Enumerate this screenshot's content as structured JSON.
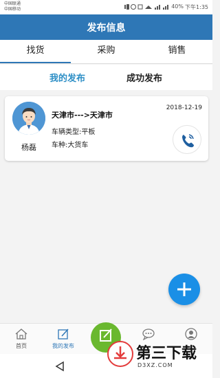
{
  "status_bar": {
    "carrier_1": "中国联通",
    "carrier_2": "中国移动",
    "battery": "40%",
    "time": "下午1:35"
  },
  "header": {
    "title": "发布信息"
  },
  "tabs": [
    {
      "label": "找货",
      "active": true
    },
    {
      "label": "采购",
      "active": false
    },
    {
      "label": "销售",
      "active": false
    }
  ],
  "sub_tabs": [
    {
      "label": "我的发布",
      "active": true
    },
    {
      "label": "成功发布",
      "active": false
    }
  ],
  "listing": {
    "contact_name": "杨磊",
    "route": "天津市--->天津市",
    "date": "2018-12-19",
    "vehicle_type": "车辆类型:平板",
    "cargo_type": "车种:大货车"
  },
  "bottom_nav": [
    {
      "label": "首页",
      "icon": "home-icon",
      "active": false
    },
    {
      "label": "我的发布",
      "icon": "edit-icon",
      "active": true
    },
    {
      "label": "",
      "icon": "post-icon",
      "active": false
    },
    {
      "label": "",
      "icon": "chat-icon",
      "active": false
    },
    {
      "label": "",
      "icon": "user-icon",
      "active": false
    }
  ],
  "watermark": {
    "title": "第三下载",
    "subtitle": "D3XZ.COM"
  },
  "colors": {
    "primary": "#2e77b6",
    "accent_text": "#2e8fc6",
    "fab": "#1a8fe6",
    "center_button": "#6ab82f"
  }
}
